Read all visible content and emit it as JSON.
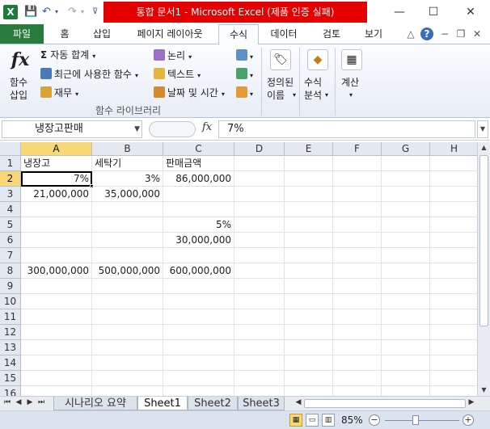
{
  "app": {
    "title": "통합 문서1 - Microsoft Excel (제품 인증 실패)",
    "logo": "X"
  },
  "window_controls": {
    "minimize": "—",
    "maximize": "☐",
    "close": "✕"
  },
  "ribbon_tabs": [
    {
      "label": "파일"
    },
    {
      "label": "홈"
    },
    {
      "label": "삽입"
    },
    {
      "label": "페이지 레이아웃"
    },
    {
      "label": "수식"
    },
    {
      "label": "데이터"
    },
    {
      "label": "검토"
    },
    {
      "label": "보기"
    }
  ],
  "ribbon": {
    "function_insert": {
      "icon": "fx",
      "line1": "함수",
      "line2": "삽입"
    },
    "autosum": "자동 합계",
    "recent": "최근에 사용한 함수",
    "financial": "재무",
    "logical": "논리",
    "text": "텍스트",
    "datetime": "날짜 및 시간",
    "group_library": "함수 라이브러리",
    "defined_names": {
      "line1": "정의된",
      "line2": "이름"
    },
    "formula_auditing": {
      "line1": "수식",
      "line2": "분석"
    },
    "calculation": "계산"
  },
  "formula_bar": {
    "name_box": "냉장고판매",
    "fx": "fx",
    "value": "7%"
  },
  "columns": [
    "A",
    "B",
    "C",
    "D",
    "E",
    "F",
    "G",
    "H"
  ],
  "rows": [
    "1",
    "2",
    "3",
    "4",
    "5",
    "6",
    "7",
    "8",
    "9",
    "10",
    "11",
    "12",
    "13",
    "14",
    "15",
    "16"
  ],
  "cells": {
    "A1": "냉장고",
    "B1": "세탁기",
    "C1": "판매금액",
    "A2": "7%",
    "B2": "3%",
    "C2": "86,000,000",
    "A3": "21,000,000",
    "B3": "35,000,000",
    "C5": "5%",
    "C6": "30,000,000",
    "A8": "300,000,000",
    "B8": "500,000,000",
    "C8": "600,000,000"
  },
  "sheet_tabs": [
    {
      "label": "시나리오 요약"
    },
    {
      "label": "Sheet1"
    },
    {
      "label": "Sheet2"
    },
    {
      "label": "Sheet3"
    }
  ],
  "status": {
    "zoom": "85%"
  }
}
